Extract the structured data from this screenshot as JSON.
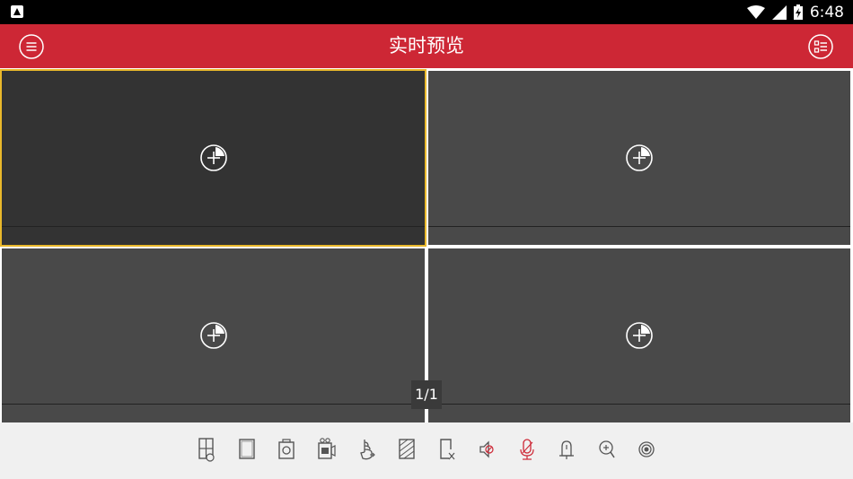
{
  "status_bar": {
    "time": "6:48",
    "icons": [
      "app-a-icon",
      "wifi-icon",
      "cellular-signal-icon",
      "battery-icon"
    ]
  },
  "header": {
    "title": "实时预览",
    "left_icon": "menu-icon",
    "right_icon": "device-list-icon",
    "color": "#cd2735"
  },
  "grid": {
    "panes": [
      {
        "selected": true,
        "icon": "add-camera-icon"
      },
      {
        "selected": false,
        "icon": "add-camera-icon"
      },
      {
        "selected": false,
        "icon": "add-camera-icon"
      },
      {
        "selected": false,
        "icon": "add-camera-icon"
      }
    ],
    "page_indicator": "1/1",
    "selected_color": "#e9b82b"
  },
  "toolbar": {
    "tools": [
      "window-layout-icon",
      "fullscreen-icon",
      "snapshot-icon",
      "record-icon",
      "ptz-icon",
      "image-quality-icon",
      "stop-all-icon",
      "audio-icon",
      "talk-icon",
      "alarm-icon",
      "zoom-icon",
      "fisheye-icon"
    ],
    "accent_color": "#cd2735"
  }
}
